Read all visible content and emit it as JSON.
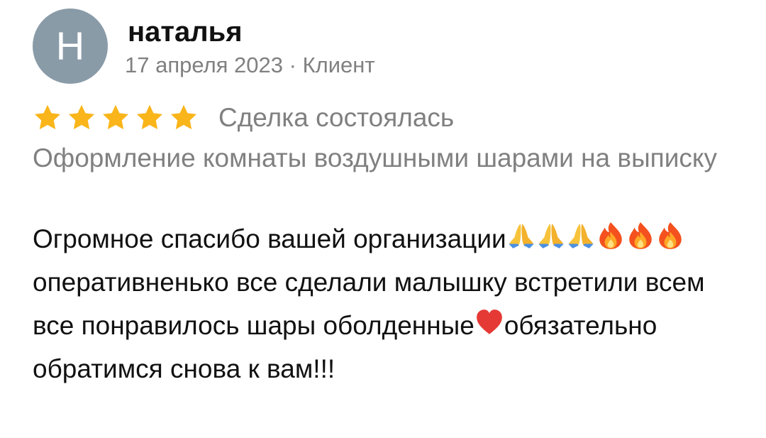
{
  "review": {
    "avatar_letter": "Н",
    "avatar_color": "#8a9ba8",
    "author_name": "наталья",
    "meta": "17 апреля 2023 · Клиент",
    "rating": 5,
    "rating_max": 5,
    "star_color": "#f9b51a",
    "deal_status": "Сделка состоялась",
    "service": "Оформление комнаты воздушными шарами на выписку",
    "text_parts": {
      "p1": "Огромное спасибо вашей организации",
      "p2": "оперативненько все сделали малышку встретили всем все понравилось шары оболденные",
      "p3": "обязательно обратимся снова к вам!!!"
    },
    "emojis": [
      "folded-hands-emoji",
      "folded-hands-emoji",
      "folded-hands-emoji",
      "fire-emoji",
      "fire-emoji",
      "fire-emoji",
      "red-heart-emoji"
    ]
  }
}
